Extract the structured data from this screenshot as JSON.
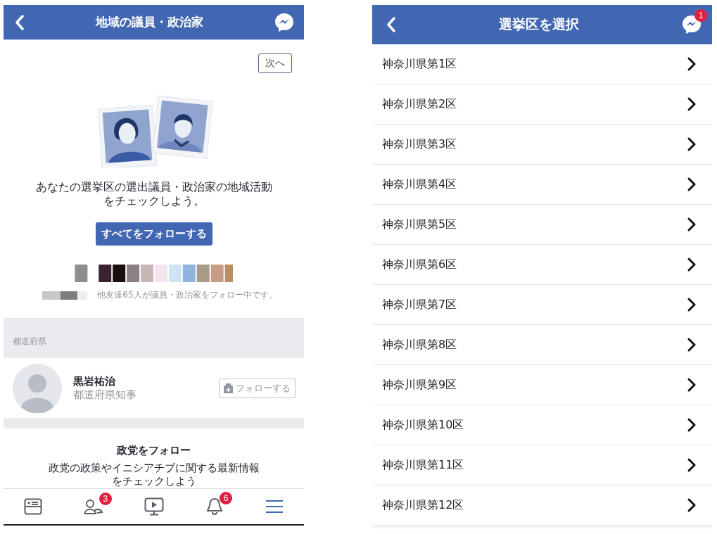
{
  "left_screen": {
    "header": {
      "title": "地域の議員・政治家"
    },
    "next_button": "次へ",
    "intro_text": "あなたの選挙区の選出議員・政治家の地域活動をチェックしよう。",
    "follow_all_button": "すべてをフォローする",
    "friends_note": "他友達65人が議員・政治家をフォロー中です。",
    "section_label": "都道府県",
    "politicians": [
      {
        "name": "黒岩祐治",
        "role": "都道府県知事",
        "follow_button": "フォローする"
      }
    ],
    "party_section": {
      "title": "政党をフォロー",
      "description": "政党の政策やイニシアチブに関する最新情報をチェックしよう"
    },
    "tabs": [
      {
        "selected": false
      },
      {
        "selected": false,
        "badge": "3"
      },
      {
        "selected": false
      },
      {
        "selected": false,
        "badge": "6"
      },
      {
        "selected": true
      }
    ]
  },
  "right_screen": {
    "header": {
      "title": "選挙区を選択",
      "messenger_badge": "1"
    },
    "districts": [
      {
        "label": "神奈川県第1区"
      },
      {
        "label": "神奈川県第2区"
      },
      {
        "label": "神奈川県第3区"
      },
      {
        "label": "神奈川県第4区"
      },
      {
        "label": "神奈川県第5区"
      },
      {
        "label": "神奈川県第6区"
      },
      {
        "label": "神奈川県第7区"
      },
      {
        "label": "神奈川県第8区"
      },
      {
        "label": "神奈川県第9区"
      },
      {
        "label": "神奈川県第10区"
      },
      {
        "label": "神奈川県第11区"
      },
      {
        "label": "神奈川県第12区"
      }
    ]
  }
}
